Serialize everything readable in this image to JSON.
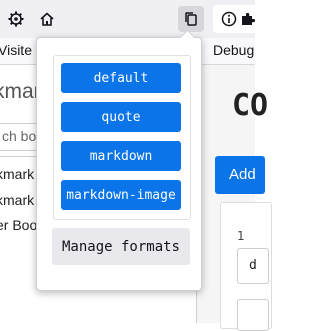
{
  "browser": {
    "bookmarks_toolbar": {
      "left_fragment": "Visite",
      "right_fragment": "Debug"
    }
  },
  "page_left": {
    "title_fragment": "kmar",
    "search_placeholder_fragment": "ch boo",
    "rows": [
      "kmark",
      "kmark",
      "er Boo"
    ]
  },
  "page_right": {
    "heading_fragment": "CO",
    "button_fragment": "Add",
    "item_number": "1",
    "field_fragment": "d"
  },
  "popup": {
    "formats": [
      {
        "label": "default"
      },
      {
        "label": "quote"
      },
      {
        "label": "markdown"
      },
      {
        "label": "markdown-image"
      }
    ],
    "manage_label": "Manage formats"
  },
  "colors": {
    "accent": "#0a74e8",
    "toolbar": "#f0f0f4",
    "secondary_button": "#e9e9ed"
  }
}
